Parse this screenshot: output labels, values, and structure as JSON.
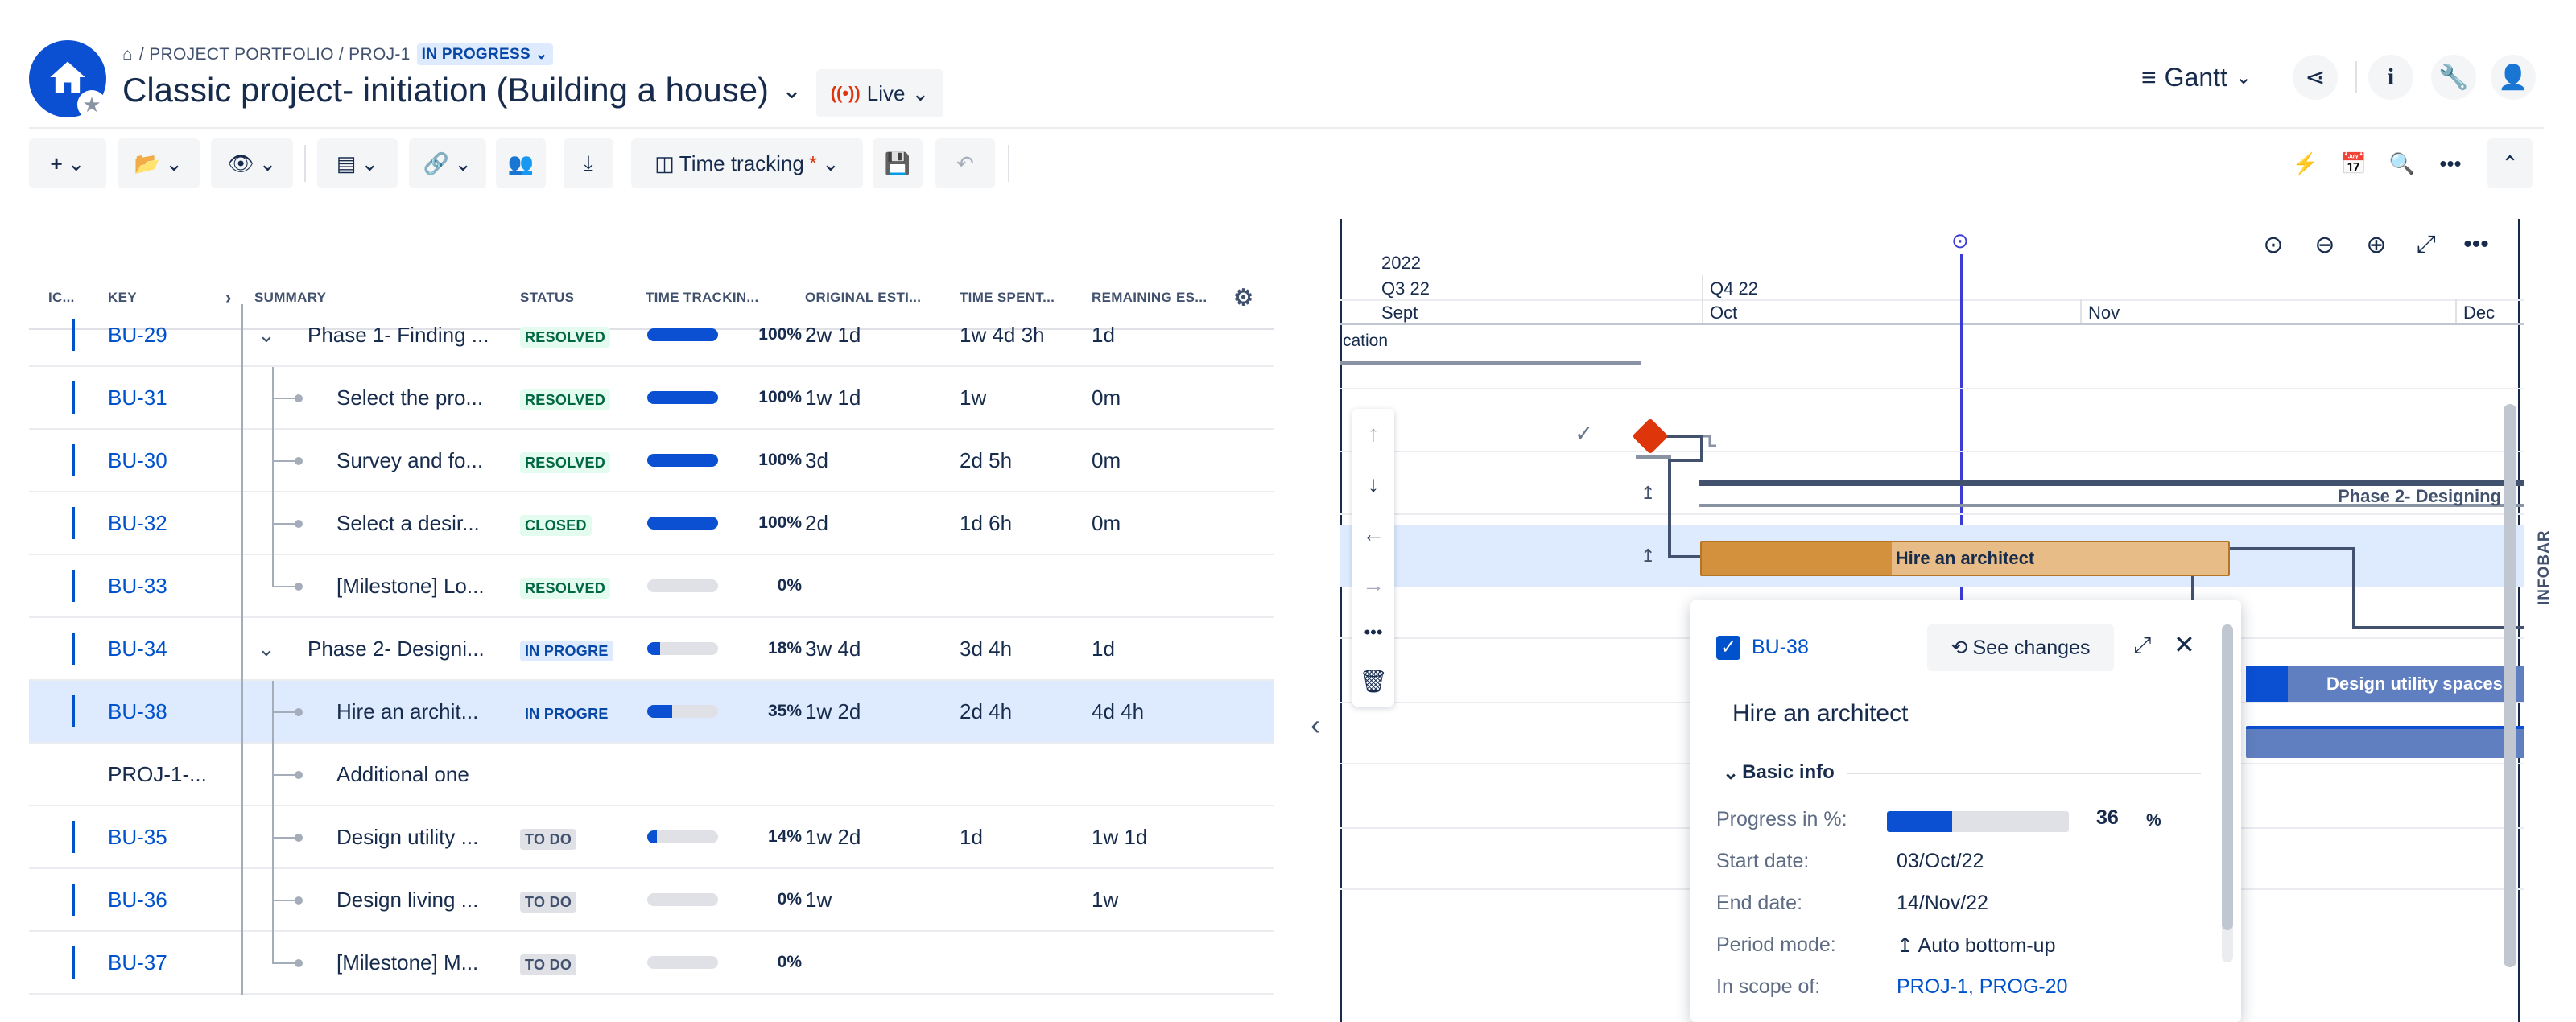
{
  "header": {
    "breadcrumb_home": "⌂",
    "breadcrumb_path": "/ PROJECT PORTFOLIO / PROJ-1",
    "status_badge": "IN PROGRESS",
    "title": "Classic project- initiation (Building a house)",
    "live_label": "Live",
    "view_label": "Gantt"
  },
  "toolbar": {
    "time_tracking_label": "Time tracking",
    "time_tracking_asterisk": "*"
  },
  "grid": {
    "columns": [
      "IC...",
      "KEY",
      "SUMMARY",
      "STATUS",
      "TIME TRACKIN...",
      "ORIGINAL ESTI...",
      "TIME SPENT...",
      "REMAINING ES..."
    ],
    "rows": [
      {
        "key": "BU-29",
        "summary": "Phase 1- Finding ...",
        "status": "RESOLVED",
        "progress": 1.0,
        "pct": "100%",
        "orig": "2w 1d",
        "spent": "1w 4d 3h",
        "remaining": "1d"
      },
      {
        "key": "BU-31",
        "summary": "Select the pro...",
        "status": "RESOLVED",
        "progress": 1.0,
        "pct": "100%",
        "orig": "1w 1d",
        "spent": "1w",
        "remaining": "0m"
      },
      {
        "key": "BU-30",
        "summary": "Survey and fo...",
        "status": "RESOLVED",
        "progress": 1.0,
        "pct": "100%",
        "orig": "3d",
        "spent": "2d 5h",
        "remaining": "0m"
      },
      {
        "key": "BU-32",
        "summary": "Select a desir...",
        "status": "CLOSED",
        "progress": 1.0,
        "pct": "100%",
        "orig": "2d",
        "spent": "1d 6h",
        "remaining": "0m"
      },
      {
        "key": "BU-33",
        "summary": "[Milestone] Lo...",
        "status": "RESOLVED",
        "progress": 0,
        "pct": "0%",
        "orig": "",
        "spent": "",
        "remaining": ""
      },
      {
        "key": "BU-34",
        "summary": "Phase 2- Designi...",
        "status": "IN PROGRE",
        "progress": 0.18,
        "pct": "18%",
        "orig": "3w 4d",
        "spent": "3d 4h",
        "remaining": "1d"
      },
      {
        "key": "BU-38",
        "summary": "Hire an archit...",
        "status": "IN PROGRE",
        "progress": 0.35,
        "pct": "35%",
        "orig": "1w 2d",
        "spent": "2d 4h",
        "remaining": "4d 4h"
      },
      {
        "key": "PROJ-1-...",
        "summary": "Additional one",
        "status": "",
        "progress": null,
        "pct": "",
        "orig": "",
        "spent": "",
        "remaining": ""
      },
      {
        "key": "BU-35",
        "summary": "Design utility ...",
        "status": "TO DO",
        "progress": 0.14,
        "pct": "14%",
        "orig": "1w 2d",
        "spent": "1d",
        "remaining": "1w 1d"
      },
      {
        "key": "BU-36",
        "summary": "Design living ...",
        "status": "TO DO",
        "progress": 0,
        "pct": "0%",
        "orig": "1w",
        "spent": "",
        "remaining": "1w"
      },
      {
        "key": "BU-37",
        "summary": "[Milestone] M...",
        "status": "TO DO",
        "progress": 0,
        "pct": "0%",
        "orig": "",
        "spent": "",
        "remaining": ""
      }
    ]
  },
  "gantt": {
    "year": "2022",
    "q3": "Q3 22",
    "q4": "Q4 22",
    "months": [
      "Sept",
      "Oct",
      "Nov",
      "Dec"
    ],
    "cut_label": "cation",
    "phase2_label": "Phase 2- Designing",
    "architect_label": "Hire an architect",
    "utility_label": "Design utility spaces",
    "infobar_label": "INFOBAR"
  },
  "popup": {
    "key": "BU-38",
    "see_changes": "See changes",
    "title": "Hire an architect",
    "section": "Basic info",
    "progress_label": "Progress in %:",
    "progress_value": "36",
    "progress_unit": "%",
    "progress_fraction": 0.36,
    "start_label": "Start date:",
    "start_value": "03/Oct/22",
    "end_label": "End date:",
    "end_value": "14/Nov/22",
    "period_label": "Period mode:",
    "period_value": "Auto bottom-up",
    "scope_label": "In scope of:",
    "scope_value": "PROJ-1, PROG-20"
  },
  "colors": {
    "accent": "#0052cc",
    "progress": "#0b4fd3",
    "architect_bar": "#d4913d",
    "milestone": "#de350b",
    "selected_row": "#deebff"
  }
}
